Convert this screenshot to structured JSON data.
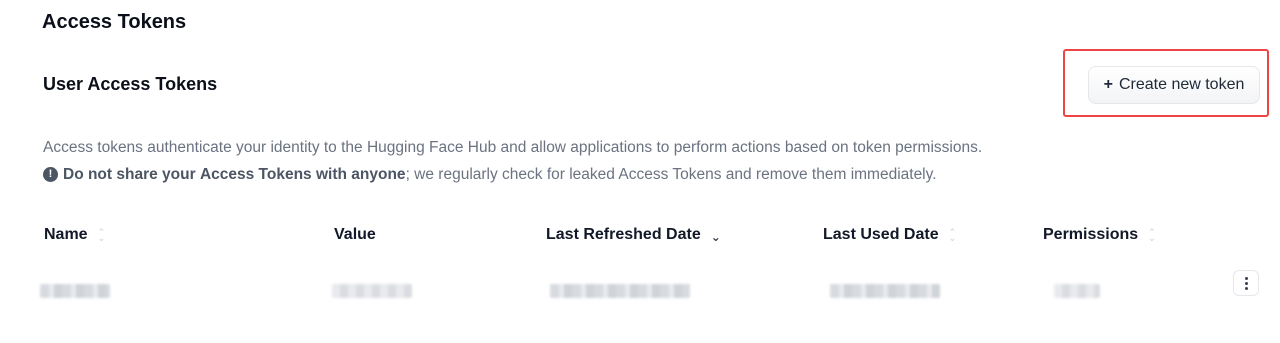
{
  "page": {
    "title": "Access Tokens"
  },
  "section": {
    "title": "User Access Tokens",
    "create_button": {
      "icon": "plus-icon",
      "label": "Create new token"
    }
  },
  "description": {
    "line1": "Access tokens authenticate your identity to the Hugging Face Hub and allow applications to perform actions based on token permissions.",
    "warning_bold_prefix": "Do not share your",
    "warning_bold_term": "Access Tokens",
    "warning_bold_suffix": "with anyone",
    "warning_rest": "; we regularly check for leaked Access Tokens and remove them immediately.",
    "warning_icon": "exclamation-circle-icon"
  },
  "table": {
    "columns": [
      {
        "label": "Name",
        "sort": "unsorted"
      },
      {
        "label": "Value",
        "sort": "none"
      },
      {
        "label": "Last Refreshed Date",
        "sort": "descending"
      },
      {
        "label": "Last Used Date",
        "sort": "unsorted"
      },
      {
        "label": "Permissions",
        "sort": "unsorted"
      }
    ],
    "rows": [
      {
        "name": "",
        "value": "",
        "last_refreshed": "",
        "last_used": "",
        "permissions": "",
        "blurred": true
      }
    ],
    "row_menu_icon": "kebab-menu-icon"
  },
  "colors": {
    "highlight_border": "#ef4444",
    "text_muted": "#6b7280"
  }
}
